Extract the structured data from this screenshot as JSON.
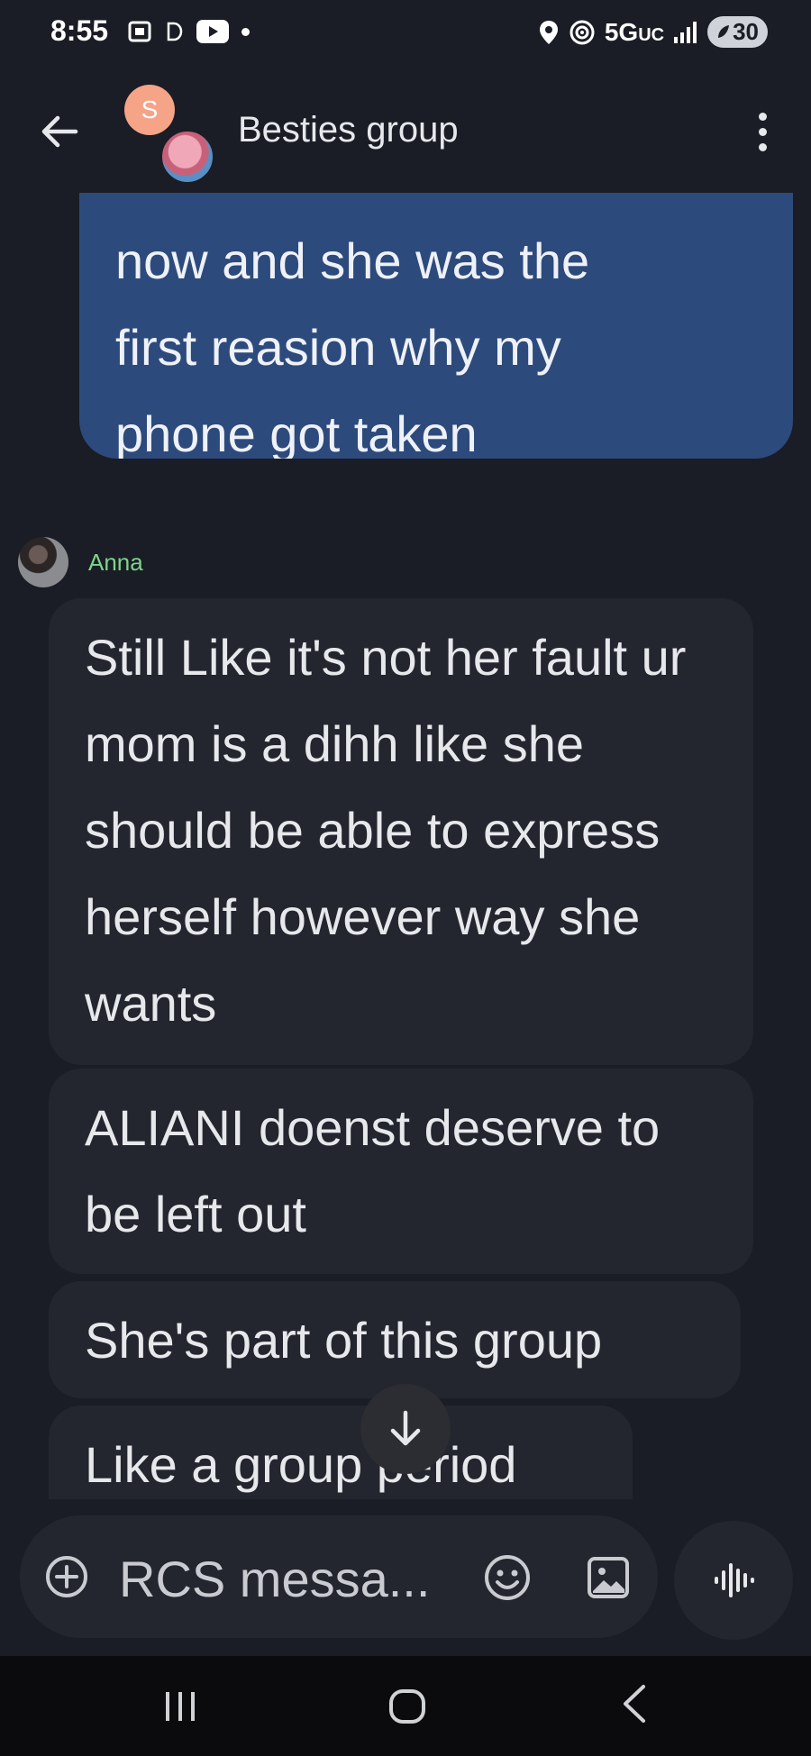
{
  "status_bar": {
    "time": "8:55",
    "network": "5G",
    "network_sub": "UC",
    "battery": "30"
  },
  "app_bar": {
    "avatar_initial": "S",
    "title": "Besties group"
  },
  "messages": {
    "sent": {
      "cut_top_line": "- - - - - - - - - - - -",
      "lines": [
        "now and she was the",
        "first reasion why my",
        "phone got taken"
      ]
    },
    "sender_name": "Anna",
    "received": [
      "Still Like it's not her fault ur mom is a dihh like she should be able to express herself however way she wants",
      "ALIANI doenst deserve to be left out",
      "She's part of this group",
      "Like a group period"
    ]
  },
  "compose": {
    "placeholder": "RCS messa..."
  },
  "colors": {
    "background": "#1a1d25",
    "sent_bubble": "#2d4a7c",
    "received_bubble": "#23262e",
    "sender_name": "#7fd38b"
  }
}
